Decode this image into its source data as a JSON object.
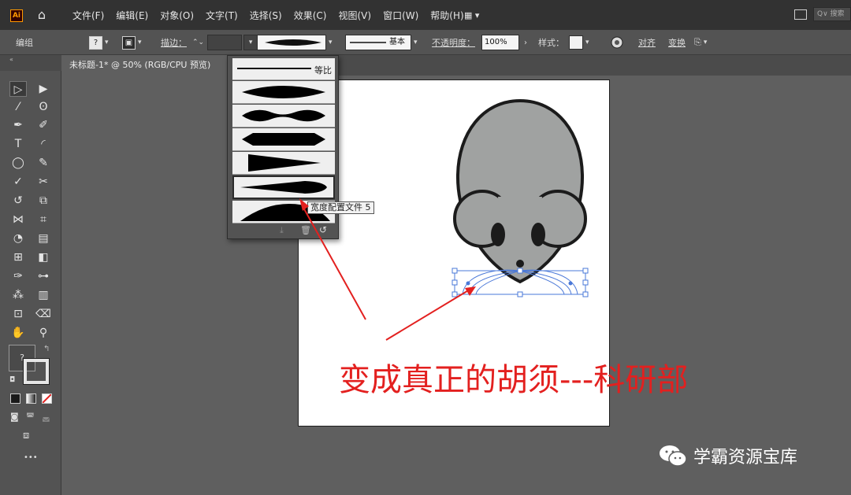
{
  "app": {
    "logo_text": "Ai",
    "menus": [
      "文件(F)",
      "编辑(E)",
      "对象(O)",
      "文字(T)",
      "选择(S)",
      "效果(C)",
      "视图(V)",
      "窗口(W)",
      "帮助(H)"
    ],
    "search_placeholder": "搜索"
  },
  "control_bar": {
    "selection_label": "编组",
    "fill_value": "?",
    "stroke_label": "描边：",
    "stroke_style_label": "基本",
    "opacity_label": "不透明度：",
    "opacity_value": "100%",
    "style_label": "样式：",
    "align_label": "对齐",
    "transform_label": "变换"
  },
  "document": {
    "tab_title": "未标题-1* @ 50% (RGB/CPU 预览)"
  },
  "width_profiles": {
    "uniform_label": "等比",
    "items": [
      "宽度配置文件 1",
      "宽度配置文件 2",
      "宽度配置文件 3",
      "宽度配置文件 4",
      "宽度配置文件 5",
      "宽度配置文件 6"
    ],
    "selected_index": 4,
    "tooltip": "宽度配置文件 5"
  },
  "toolbar": {
    "fill_placeholder": "?",
    "more_label": "•••"
  },
  "annotation": {
    "caption": "变成真正的胡须---科研部",
    "watermark": "学霸资源宝库"
  },
  "colors": {
    "accent_red": "#e3201f",
    "mouse_gray": "#a0a2a1",
    "selection_blue": "#4a78d8",
    "ai_orange": "#ff9a00"
  }
}
